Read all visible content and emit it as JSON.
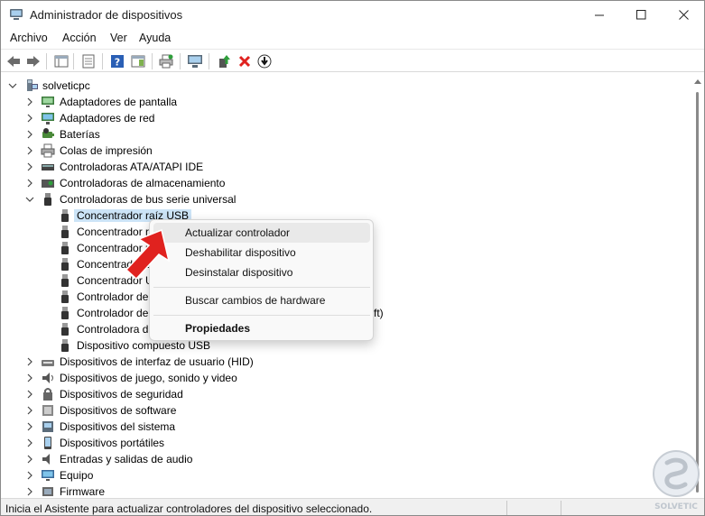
{
  "window": {
    "title": "Administrador de dispositivos"
  },
  "menu": [
    "Archivo",
    "Acción",
    "Ver",
    "Ayuda"
  ],
  "tree": {
    "root": "solveticpc",
    "categories": [
      {
        "label": "Adaptadores de pantalla",
        "icon": "display-adapter-icon",
        "expanded": false
      },
      {
        "label": "Adaptadores de red",
        "icon": "network-adapter-icon",
        "expanded": false
      },
      {
        "label": "Baterías",
        "icon": "battery-icon",
        "expanded": false
      },
      {
        "label": "Colas de impresión",
        "icon": "printer-icon",
        "expanded": false
      },
      {
        "label": "Controladoras ATA/ATAPI IDE",
        "icon": "ide-controller-icon",
        "expanded": false
      },
      {
        "label": "Controladoras de almacenamiento",
        "icon": "storage-controller-icon",
        "expanded": false
      },
      {
        "label": "Controladoras de bus serie universal",
        "icon": "usb-icon",
        "expanded": true
      }
    ],
    "usb_children": [
      "Concentrador raíz USB",
      "Concentrador r",
      "Concentrador r",
      "Concentrador U",
      "Concentrador U",
      "Controlador de",
      "Controlador de",
      "Controladora d",
      "Dispositivo compuesto USB"
    ],
    "overflow_tail": "ft)",
    "more_categories": [
      {
        "label": "Dispositivos de interfaz de usuario (HID)",
        "icon": "hid-icon"
      },
      {
        "label": "Dispositivos de juego, sonido y video",
        "icon": "speaker-icon"
      },
      {
        "label": "Dispositivos de seguridad",
        "icon": "security-icon"
      },
      {
        "label": "Dispositivos de software",
        "icon": "software-device-icon"
      },
      {
        "label": "Dispositivos del sistema",
        "icon": "system-device-icon"
      },
      {
        "label": "Dispositivos portátiles",
        "icon": "portable-device-icon"
      },
      {
        "label": "Entradas y salidas de audio",
        "icon": "audio-io-icon"
      },
      {
        "label": "Equipo",
        "icon": "computer-icon"
      },
      {
        "label": "Firmware",
        "icon": "firmware-icon"
      }
    ]
  },
  "context_menu": {
    "update": "Actualizar controlador",
    "disable": "Deshabilitar dispositivo",
    "uninstall": "Desinstalar dispositivo",
    "scan": "Buscar cambios de hardware",
    "properties": "Propiedades"
  },
  "status": "Inicia el Asistente para actualizar controladores del dispositivo seleccionado.",
  "watermark": "SOLVETIC",
  "colors": {
    "selection": "#cce4f7",
    "accent_red": "#e0221f",
    "toolbar_green": "#2e9e3b"
  }
}
